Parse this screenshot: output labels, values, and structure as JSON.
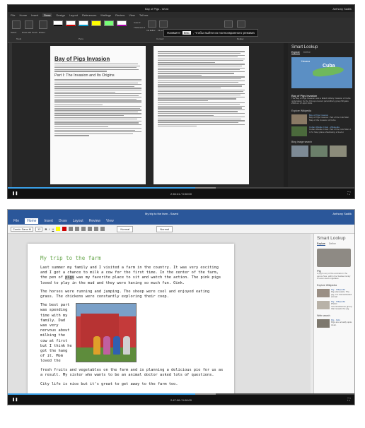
{
  "video1": {
    "titlebar": {
      "title": "Bay of Pigs - Word",
      "user": "Anthony Sadlik",
      "window_controls": "— ☐ ✕"
    },
    "menu": [
      "File",
      "Home",
      "Insert",
      "Draw",
      "Design",
      "Layout",
      "References",
      "Mailings",
      "Review",
      "View",
      "Tell me"
    ],
    "menu_active_index": 3,
    "ribbon": {
      "tools": [
        "Select",
        "Draw with Touch",
        "Eraser"
      ],
      "pens_group": "Pens",
      "convert": [
        "Color ▾",
        "Thickness ▾"
      ],
      "right_tools": [
        "Ink Editor",
        "Ink to Shape",
        "Ink to Math",
        "Replay"
      ],
      "group_labels": [
        "Tools",
        "Convert",
        "Replay"
      ]
    },
    "toast": {
      "before": "Нажмите",
      "key": "Esc",
      "after": ", чтобы выйти из полноэкранного режима"
    },
    "doc": {
      "title": "Bay of Pigs Invasion",
      "heading": "Part I: The Invasion and Its Origins"
    },
    "smart_lookup": {
      "title": "Smart Lookup",
      "tabs": [
        "Explore",
        "Define"
      ],
      "map_labels": {
        "country": "Cuba",
        "city": "Havana"
      },
      "result_title": "Bay of Pigs Invasion",
      "result_text": "The Bay of Pigs Invasion was a failed military invasion of Cuba undertaken by the CIA-sponsored paramilitary group Brigade 2506 on 17 April 1961.",
      "explore_label": "Explore Wikipedia",
      "wiki": [
        {
          "title": "Bay of Pigs Invasion",
          "text": "Bay of Pigs Invasion: Part of the Cold War. Map of the invasion of Cuba"
        },
        {
          "title": "Cuban Missile Crisis - Wikipedia",
          "text": "Cuban Missile Crisis: Part of the Cold War. A U.S. Navy plane shadowing a Soviet"
        }
      ],
      "image_label": "Bing image search"
    },
    "player": {
      "time": "2:46:41 / 5:08:00",
      "progress": 0.54
    }
  },
  "video2": {
    "titlebar": {
      "title": "My trip to the farm - Saved",
      "user": "Anthony Sadlik"
    },
    "menu": [
      "File",
      "Home",
      "Insert",
      "Draw",
      "Layout",
      "Review",
      "View"
    ],
    "menu_active_index": 1,
    "ribbon": {
      "font": "Comic Sans M",
      "size": "12",
      "style1": "Normal",
      "style2": "Normal"
    },
    "doc": {
      "title": "My trip to the farm",
      "p1_a": "Last summer my family and I visited a farm in the country.  It was very exciting and I got a chance to milk a cow for the first time.  In the center of the farm, the pen of ",
      "p1_hl": "pigs",
      "p1_b": " was my favorite place to sit and watch the action. The pink pigs loved to play in the mud and they were having so much fun. Oink.",
      "p2": "The horses were running and jumping.  The sheep were cool and enjoyed eating grass.  The chickens were constantly exploring their coop.",
      "p3_wrap": "The best part was spending time with my family.  Dad was very nervous about milking the cow at first but I think he got the hang of it.  Mom loved the",
      "p3_rest": "fresh fruits and vegetables on the farm and is planning a delicious pie for us as a result.  My sister who wants to be an animal doctor asked lots of questions.",
      "p4": "City life is nice but it's great to get away to the farm too."
    },
    "smart_lookup": {
      "title": "Smart Lookup",
      "tabs": [
        "Explore",
        "Define"
      ],
      "result_title": "Pig",
      "result_text": "A pig is any of the animals in the genus Sus, within the Suidae family of even-toed ungulates.",
      "explore_label": "Explore Wikipedia",
      "wiki": [
        {
          "title": "Pig - Wikipedia",
          "text": "Pig (domestic). The pig, is a domesticated animal"
        },
        {
          "title": "Pig - Wikipedia",
          "text": "PSCO reconnaissance group that reveals the pig"
        }
      ],
      "web_label": "Web search",
      "web": [
        {
          "title": "Pig - Kids",
          "text": "Pigs are actually quite clean."
        }
      ]
    },
    "player": {
      "time": "2:47:06 / 5:08:00",
      "progress": 0.54
    }
  },
  "colors": {
    "word_blue": "#2b579a",
    "progress": "#3aa0e8",
    "title_green": "#6aa84f"
  }
}
